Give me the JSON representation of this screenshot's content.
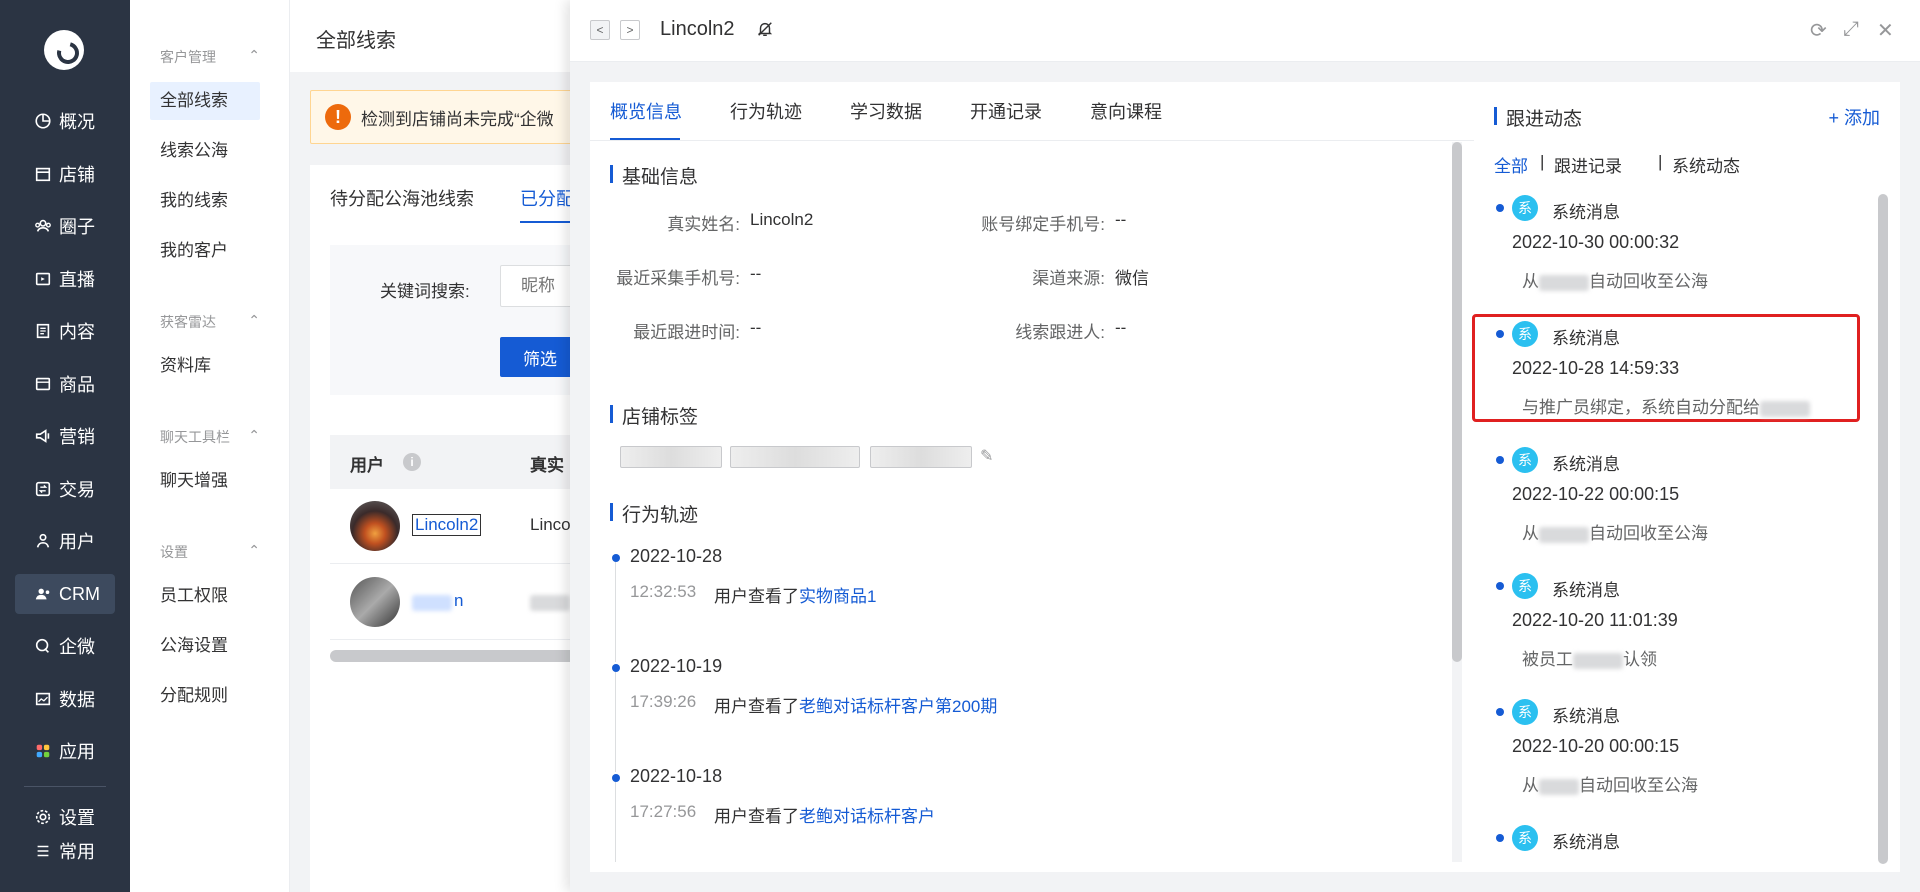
{
  "nav": {
    "items": [
      {
        "label": "概况",
        "icon": "pie-chart-icon"
      },
      {
        "label": "店铺",
        "icon": "shop-icon"
      },
      {
        "label": "圈子",
        "icon": "group-icon"
      },
      {
        "label": "直播",
        "icon": "live-icon"
      },
      {
        "label": "内容",
        "icon": "document-icon"
      },
      {
        "label": "商品",
        "icon": "goods-icon"
      },
      {
        "label": "营销",
        "icon": "megaphone-icon"
      },
      {
        "label": "交易",
        "icon": "trade-icon"
      },
      {
        "label": "用户",
        "icon": "user-icon"
      },
      {
        "label": "CRM",
        "icon": "crm-icon"
      },
      {
        "label": "企微",
        "icon": "wecom-icon"
      },
      {
        "label": "数据",
        "icon": "data-icon"
      },
      {
        "label": "应用",
        "icon": "apps-icon"
      }
    ],
    "settings_label": "设置",
    "common_label": "常用"
  },
  "subnav": {
    "groups": [
      {
        "title": "客户管理",
        "items": [
          "全部线索",
          "线索公海",
          "我的线索",
          "我的客户"
        ]
      },
      {
        "title": "获客雷达",
        "items": [
          "资料库"
        ]
      },
      {
        "title": "聊天工具栏",
        "items": [
          "聊天增强"
        ]
      },
      {
        "title": "设置",
        "items": [
          "员工权限",
          "公海设置",
          "分配规则"
        ]
      }
    ]
  },
  "main": {
    "title": "全部线索",
    "notice": "检测到店铺尚未完成“企微",
    "tabs": [
      "待分配公海池线索",
      "已分配"
    ],
    "keyword_label": "关键词搜索:",
    "keyword_placeholder": "昵称",
    "filter_button": "筛选",
    "table_headers": [
      "用户",
      "真实"
    ],
    "rows": [
      {
        "user": "Lincoln2",
        "real": "Linco"
      },
      {
        "user": "n",
        "real": ""
      }
    ]
  },
  "drawer": {
    "title": "Lincoln2",
    "tabs": [
      "概览信息",
      "行为轨迹",
      "学习数据",
      "开通记录",
      "意向课程"
    ],
    "basic_title": "基础信息",
    "fields": [
      {
        "label": "真实姓名:",
        "value": "Lincoln2"
      },
      {
        "label": "账号绑定手机号:",
        "value": "--"
      },
      {
        "label": "最近采集手机号:",
        "value": "--"
      },
      {
        "label": "渠道来源:",
        "value": "微信"
      },
      {
        "label": "最近跟进时间:",
        "value": "--"
      },
      {
        "label": "线索跟进人:",
        "value": "--"
      }
    ],
    "tags_title": "店铺标签",
    "tags": [
      "",
      "",
      ""
    ],
    "trail_title": "行为轨迹",
    "trail": [
      {
        "date": "2022-10-28",
        "time": "12:32:53",
        "prefix": "用户查看了",
        "link": "实物商品1"
      },
      {
        "date": "2022-10-19",
        "time": "17:39:26",
        "prefix": "用户查看了",
        "link": "老鲍对话标杆客户第200期"
      },
      {
        "date": "2022-10-18",
        "time": "17:27:56",
        "prefix": "用户查看了",
        "link": "老鲍对话标杆客户"
      }
    ]
  },
  "follow": {
    "title": "跟进动态",
    "add": "+ 添加",
    "filters": [
      "全部",
      "跟进记录",
      "系统动态"
    ],
    "badge": "系",
    "entries": [
      {
        "type": "系统消息",
        "time": "2022-10-30 00:00:32",
        "desc_pre": "从",
        "desc_post": "自动回收至公海"
      },
      {
        "type": "系统消息",
        "time": "2022-10-28 14:59:33",
        "desc_pre": "与推广员绑定，系统自动分配给",
        "desc_post": ""
      },
      {
        "type": "系统消息",
        "time": "2022-10-22 00:00:15",
        "desc_pre": "从",
        "desc_post": "自动回收至公海"
      },
      {
        "type": "系统消息",
        "time": "2022-10-20 11:01:39",
        "desc_pre": "被员工",
        "desc_post": "认领"
      },
      {
        "type": "系统消息",
        "time": "2022-10-20 00:00:15",
        "desc_pre": "从",
        "desc_post": "自动回收至公海"
      },
      {
        "type": "系统消息",
        "time": "",
        "desc_pre": "",
        "desc_post": ""
      }
    ]
  },
  "colors": {
    "primary": "#155bd4",
    "nav_bg": "#2b3443",
    "badge": "#2bc0f0",
    "highlight": "#e02020"
  }
}
